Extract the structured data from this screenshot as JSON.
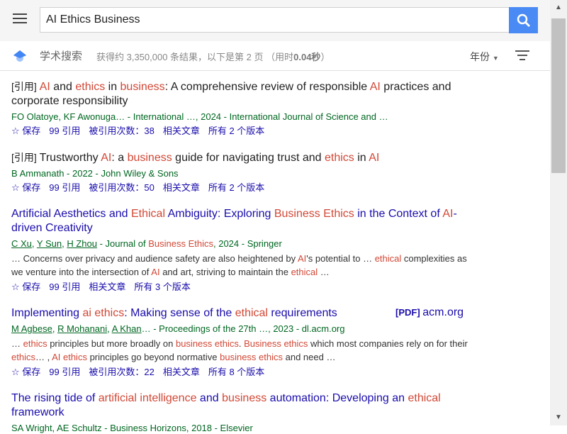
{
  "search": {
    "query": "AI Ethics Business"
  },
  "subbar": {
    "title": "学术搜索",
    "stats": "获得约 3,350,000 条结果，以下是第 2 页 （用时",
    "time": "0.04秒",
    "stats_end": "）",
    "year": "年份"
  },
  "results": [
    {
      "tag": "[引用]",
      "title_parts": [
        [
          "AI",
          "h"
        ],
        [
          " and ",
          "n"
        ],
        [
          "ethics",
          "h"
        ],
        [
          " in ",
          "n"
        ],
        [
          "business",
          "h"
        ],
        [
          ": A comprehensive review of responsible ",
          "n"
        ],
        [
          "AI",
          "h"
        ],
        [
          " practices and corporate responsibility",
          "n"
        ]
      ],
      "authors": "FO Olatoye, KF Awonuga… - International …, 2024 - International Journal of Science and …",
      "actions": [
        "☆ 保存",
        "99 引用",
        "被引用次数：38",
        "相关文章",
        "所有 2 个版本"
      ]
    },
    {
      "tag": "[引用]",
      "title_parts": [
        [
          "Trustworthy ",
          "n"
        ],
        [
          "AI",
          "h"
        ],
        [
          ": a ",
          "n"
        ],
        [
          "business",
          "h"
        ],
        [
          " guide for navigating trust and ",
          "n"
        ],
        [
          "ethics",
          "h"
        ],
        [
          " in ",
          "n"
        ],
        [
          "AI",
          "h"
        ]
      ],
      "authors": "B Ammanath - 2022 - John Wiley & Sons",
      "actions": [
        "☆ 保存",
        "99 引用",
        "被引用次数：50",
        "相关文章",
        "所有 2 个版本"
      ]
    },
    {
      "title_parts": [
        [
          "Artificial Aesthetics and ",
          "n"
        ],
        [
          "Ethical",
          "h"
        ],
        [
          " Ambiguity: Exploring ",
          "n"
        ],
        [
          "Business Ethics",
          "h"
        ],
        [
          " in the Context of ",
          "n"
        ],
        [
          "AI",
          "h"
        ],
        [
          "-driven Creativity",
          "n"
        ]
      ],
      "authors_html": [
        "C Xu",
        "Y Sun",
        "H Zhou",
        " - Journal of ",
        "Business Ethics",
        ", 2024 - Springer"
      ],
      "snippet_parts": [
        [
          "… Concerns over privacy and audience safety are also heightened by ",
          "n"
        ],
        [
          "AI",
          "h"
        ],
        [
          "'s potential to … ",
          "n"
        ],
        [
          "ethical",
          "h"
        ],
        [
          " complexities as we venture into the intersection of ",
          "n"
        ],
        [
          "AI",
          "h"
        ],
        [
          " and art, striving to maintain the ",
          "n"
        ],
        [
          "ethical",
          "h"
        ],
        [
          " …",
          "n"
        ]
      ],
      "actions": [
        "☆ 保存",
        "99 引用",
        "相关文章",
        "所有 3 个版本"
      ]
    },
    {
      "title_parts": [
        [
          "Implementing ",
          "n"
        ],
        [
          "ai ethics",
          "h"
        ],
        [
          ": Making sense of the ",
          "n"
        ],
        [
          "ethical",
          "h"
        ],
        [
          " requirements",
          "n"
        ]
      ],
      "pdf": {
        "tag": "[PDF]",
        "site": "acm.org"
      },
      "authors_html": [
        "M Agbese",
        "R Mohanani",
        "A Khan",
        "… - Proceedings of the 27th …, 2023 - dl.acm.org"
      ],
      "snippet_parts": [
        [
          "… ",
          "n"
        ],
        [
          "ethics",
          "h"
        ],
        [
          " principles but more broadly on ",
          "n"
        ],
        [
          "business ethics",
          "h"
        ],
        [
          ". ",
          "n"
        ],
        [
          "Business ethics",
          "h"
        ],
        [
          " which most companies rely on for their ",
          "n"
        ],
        [
          "ethics",
          "h"
        ],
        [
          "… , ",
          "n"
        ],
        [
          "AI ethics",
          "h"
        ],
        [
          " principles go beyond normative ",
          "n"
        ],
        [
          "business ethics",
          "h"
        ],
        [
          " and need …",
          "n"
        ]
      ],
      "actions": [
        "☆ 保存",
        "99 引用",
        "被引用次数：22",
        "相关文章",
        "所有 8 个版本"
      ]
    },
    {
      "title_parts": [
        [
          "The rising tide of ",
          "n"
        ],
        [
          "artificial intelligence",
          "h"
        ],
        [
          " and ",
          "n"
        ],
        [
          "business",
          "h"
        ],
        [
          " automation: Developing an ",
          "n"
        ],
        [
          "ethical",
          "h"
        ],
        [
          " framework",
          "n"
        ]
      ],
      "authors": "SA Wright, AE Schultz - Business Horizons, 2018 - Elsevier"
    }
  ]
}
